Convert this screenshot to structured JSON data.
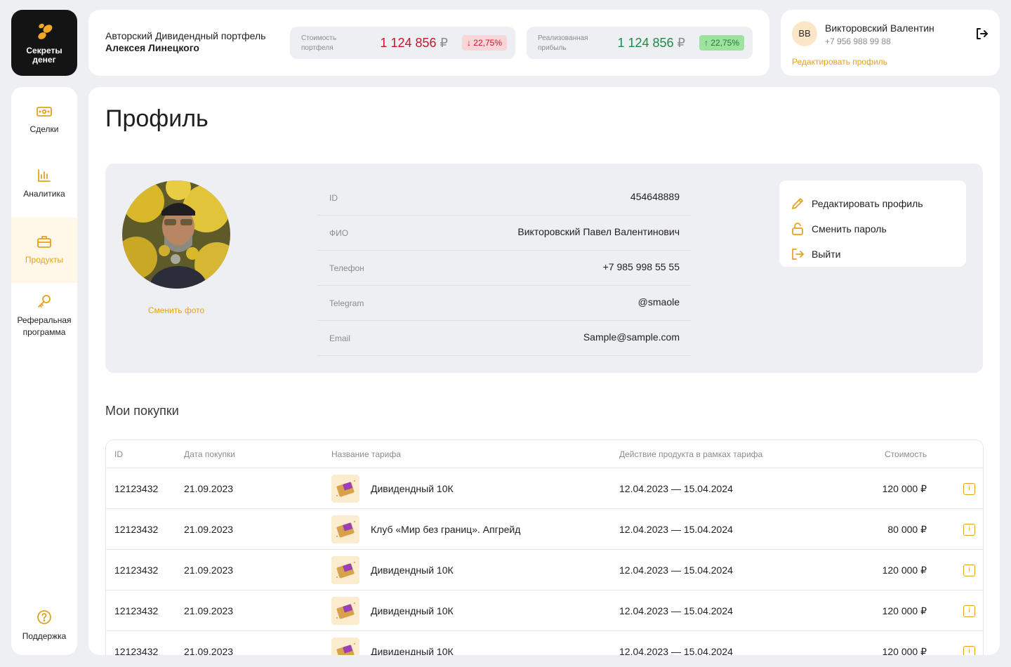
{
  "brand": {
    "name": "Секреты\nденег"
  },
  "header": {
    "portfolio_title_line1": "Авторский Дивидендный портфель",
    "portfolio_title_line2": "Алексея Линецкого",
    "metrics": [
      {
        "label": "Стоимость портфеля",
        "value": "1 124 856",
        "currency": "₽",
        "change": "↓ 22,75%",
        "trend": "down"
      },
      {
        "label": "Реализованная прибыль",
        "value": "1 124 856",
        "currency": "₽",
        "change": "↑ 22,75%",
        "trend": "up"
      }
    ]
  },
  "user": {
    "initials": "ВВ",
    "name": "Викторовский Валентин",
    "phone": "+7 956 988 99 88",
    "edit_link": "Редактировать профиль"
  },
  "sidebar": {
    "items": [
      {
        "label": "Сделки",
        "icon": "money-icon",
        "active": false
      },
      {
        "label": "Аналитика",
        "icon": "bar-chart-icon",
        "active": false
      },
      {
        "label": "Продукты",
        "icon": "briefcase-icon",
        "active": true
      },
      {
        "label": "Реферальная программа",
        "icon": "key-icon",
        "active": false
      },
      {
        "label": "Поддержка",
        "icon": "help-icon",
        "active": false
      }
    ]
  },
  "page": {
    "title": "Профиль"
  },
  "profile": {
    "change_photo": "Сменить фото",
    "fields": [
      {
        "label": "ID",
        "value": "454648889"
      },
      {
        "label": "ФИО",
        "value": "Викторовский Павел Валентинович"
      },
      {
        "label": "Телефон",
        "value": "+7 985 998 55 55"
      },
      {
        "label": "Telegram",
        "value": "@smaole"
      },
      {
        "label": "Email",
        "value": "Sample@sample.com"
      }
    ],
    "actions": [
      {
        "label": "Редактировать профиль",
        "icon": "pencil-icon"
      },
      {
        "label": "Сменить пароль",
        "icon": "lock-icon"
      },
      {
        "label": "Выйти",
        "icon": "logout-icon"
      }
    ]
  },
  "purchases": {
    "title": "Мои покупки",
    "columns": [
      "ID",
      "Дата покупки",
      "Название тарифа",
      "Действие продукта в рамках тарифа",
      "Стоимость"
    ],
    "rows": [
      {
        "id": "12123432",
        "date": "21.09.2023",
        "tariff": "Дивидендный 10К",
        "period": "12.04.2023 — 15.04.2024",
        "price": "120 000 ₽"
      },
      {
        "id": "12123432",
        "date": "21.09.2023",
        "tariff": "Клуб «Мир без границ». Апгрейд",
        "period": "12.04.2023 — 15.04.2024",
        "price": "80 000 ₽"
      },
      {
        "id": "12123432",
        "date": "21.09.2023",
        "tariff": "Дивидендный 10К",
        "period": "12.04.2023 — 15.04.2024",
        "price": "120 000 ₽"
      },
      {
        "id": "12123432",
        "date": "21.09.2023",
        "tariff": "Дивидендный 10К",
        "period": "12.04.2023 — 15.04.2024",
        "price": "120 000 ₽"
      },
      {
        "id": "12123432",
        "date": "21.09.2023",
        "tariff": "Дивидендный 10К",
        "period": "12.04.2023 — 15.04.2024",
        "price": "120 000 ₽"
      }
    ],
    "info_button": "i"
  },
  "colors": {
    "accent": "#e3a21a",
    "negative": "#d10f2a",
    "positive": "#1d8a46",
    "background": "#eeeff3"
  }
}
